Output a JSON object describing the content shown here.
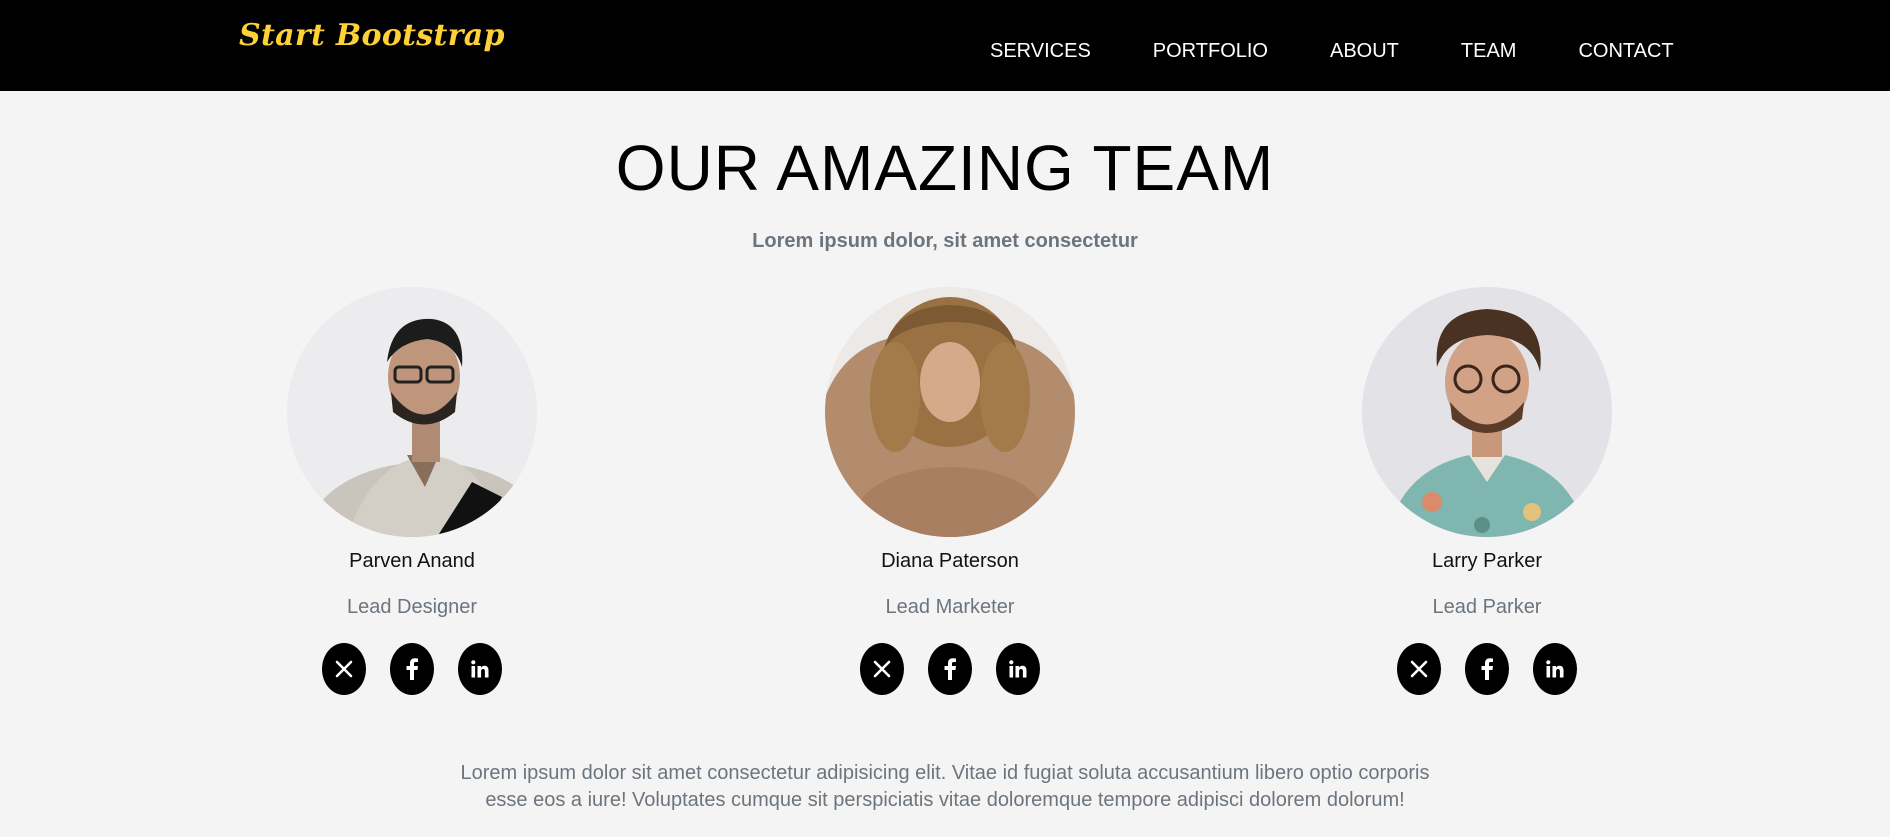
{
  "navbar": {
    "brand": "Start Bootstrap",
    "links": [
      "SERVICES",
      "PORTFOLIO",
      "ABOUT",
      "TEAM",
      "CONTACT"
    ]
  },
  "team": {
    "title": "OUR AMAZING TEAM",
    "subtitle": "Lorem ipsum dolor, sit amet consectetur",
    "members": [
      {
        "name": "Parven Anand",
        "role": "Lead Designer"
      },
      {
        "name": "Diana Paterson",
        "role": "Lead Marketer"
      },
      {
        "name": "Larry Parker",
        "role": "Lead Parker"
      }
    ],
    "social_icons": [
      "x-icon",
      "facebook-icon",
      "linkedin-icon"
    ],
    "lead_line1": "Lorem ipsum dolor sit amet consectetur adipisicing elit. Vitae id fugiat soluta accusantium libero optio corporis",
    "lead_line2": "esse eos a iure! Voluptates cumque sit perspiciatis vitae doloremque tempore adipisci dolorem dolorum!"
  },
  "colors": {
    "navbar_bg": "#000000",
    "brand": "#fed136",
    "page_bg": "#f4f4f4",
    "muted_text": "#6c757d"
  }
}
